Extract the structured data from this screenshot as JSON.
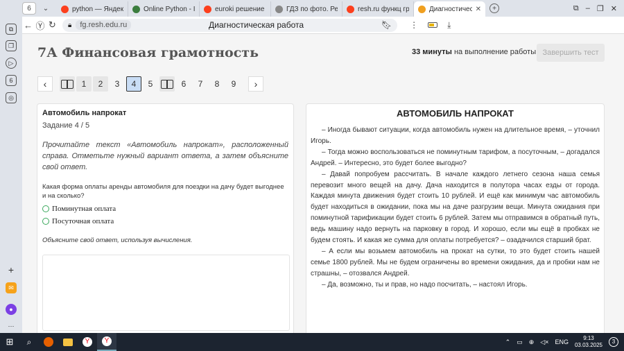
{
  "browser": {
    "tab_counter": "6",
    "tabs": [
      {
        "label": "python — Яндекс",
        "color": "#fc3f1d"
      },
      {
        "label": "Online Python - IDE",
        "color": "#3b7d3e"
      },
      {
        "label": "euroki решение за",
        "color": "#fc3f1d"
      },
      {
        "label": "ГДЗ по фото. Реш",
        "color": "#888888"
      },
      {
        "label": "resh.ru функц гра",
        "color": "#fc3f1d"
      },
      {
        "label": "Диагностическ",
        "color": "#f0a020"
      }
    ],
    "url_domain": "fg.resh.edu.ru",
    "page_title": "Диагностическая работа"
  },
  "page": {
    "heading": "7А Финансовая грамотность",
    "timer_value": "33 минуты",
    "timer_suffix": "на выполнение работы",
    "finish_label": "Завершить тест"
  },
  "pager": {
    "items": [
      "1",
      "2",
      "3",
      "4",
      "5",
      "6",
      "7",
      "8",
      "9"
    ],
    "current": "4",
    "prev_icon": "‹",
    "next_icon": "›"
  },
  "task": {
    "title": "Автомобиль напрокат",
    "number": "Задание 4 / 5",
    "instruction": "Прочитайте текст «Автомобиль напрокат», расположенный справа. Отметьте нужный вариант ответа, а затем объясните свой ответ.",
    "question": "Какая форма оплаты аренды автомобиля для поездки на дачу будет выгоднее и на сколько?",
    "options": [
      "Поминутная оплата",
      "Посуточная оплата"
    ],
    "explain": "Объясните свой ответ, используя вычисления."
  },
  "text": {
    "title": "АВТОМОБИЛЬ НАПРОКАТ",
    "paragraphs": [
      "– Иногда бывают ситуации, когда автомобиль нужен на длительное время, – уточнил Игорь.",
      "– Тогда можно воспользоваться не поминутным тарифом, а посуточным, – догадался Андрей. – Интересно, это будет более выгодно?",
      "– Давай попробуем рассчитать. В начале каждого летнего сезона наша семья перевозит много вещей на дачу. Дача находится в полутора часах езды от города. Каждая минута движения будет стоить 10 рублей. И ещё как минимум час автомобиль будет находиться в ожидании, пока мы на даче разгрузим вещи. Минута ожидания при поминутной тарификации будет стоить 6 рублей. Затем мы отправимся в обратный путь, ведь машину надо вернуть на парковку в город. И хорошо, если мы ещё в пробках не будем стоять. И какая же сумма для оплаты потребуется? – озадачился старший брат.",
      "– А если мы возьмем автомобиль на прокат на сутки, то это будет стоить нашей семье 1800 рублей. Мы не будем ограничены во времени ожидания, да и пробки нам не страшны, – отозвался Андрей.",
      "– Да, возможно, ты и прав, но надо посчитать, – настоял Игорь."
    ]
  },
  "system": {
    "lang": "ENG",
    "time": "9:13",
    "date": "03.03.2025",
    "notifications": "3"
  }
}
